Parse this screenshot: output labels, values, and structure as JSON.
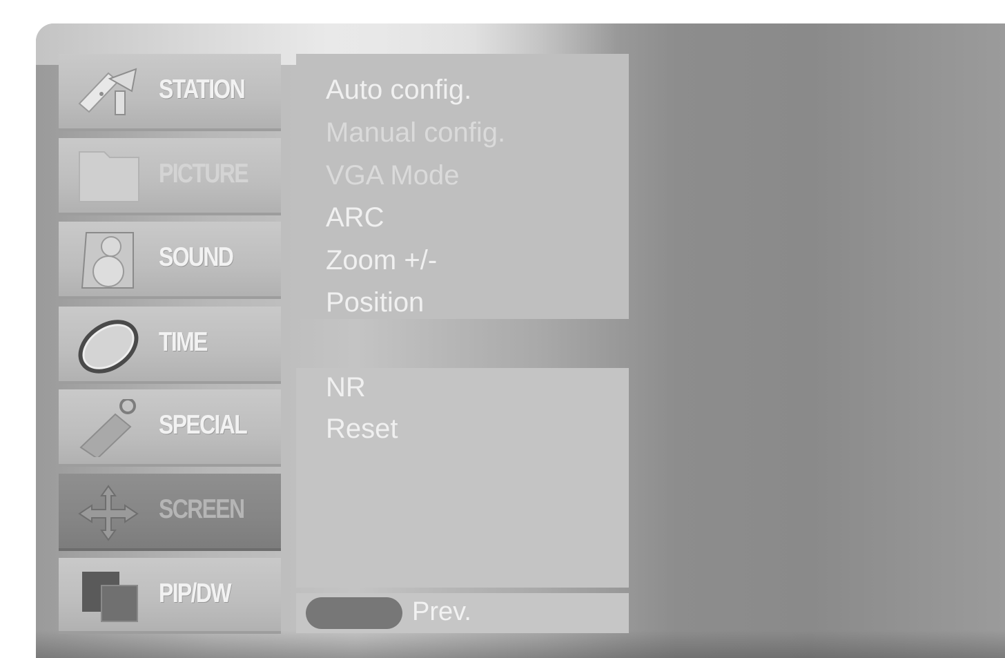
{
  "menu": {
    "items": [
      {
        "label": "STATION",
        "icon": "satellite-dish-icon",
        "active": false
      },
      {
        "label": "PICTURE",
        "icon": "picture-folder-icon",
        "active": false
      },
      {
        "label": "SOUND",
        "icon": "speaker-icon",
        "active": false
      },
      {
        "label": "TIME",
        "icon": "clock-ring-icon",
        "active": false
      },
      {
        "label": "SPECIAL",
        "icon": "key-tag-icon",
        "active": false
      },
      {
        "label": "SCREEN",
        "icon": "move-arrows-icon",
        "active": true
      },
      {
        "label": "PIP/DW",
        "icon": "pip-window-icon",
        "active": false
      }
    ]
  },
  "submenu": {
    "top_items": [
      "Auto config.",
      "Manual config.",
      "VGA Mode",
      "ARC",
      "Zoom +/-",
      "Position"
    ],
    "bottom_items": [
      "NR",
      "Reset"
    ]
  },
  "footer": {
    "prev_label": "Prev."
  },
  "colors": {
    "active_item": "#858585",
    "inactive_item": "#bdbdbd",
    "text": "#f2f2f2",
    "prev_button": "#777777"
  }
}
